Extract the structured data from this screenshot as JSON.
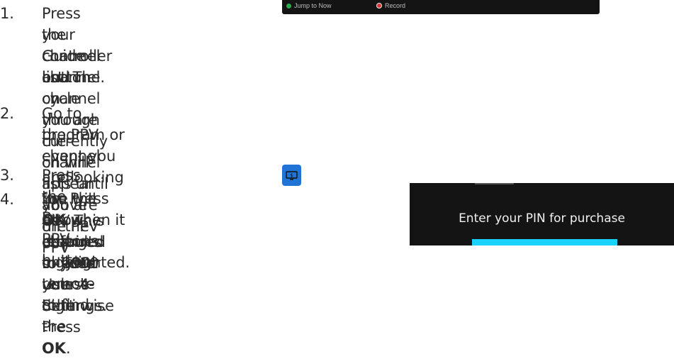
{
  "strip": {
    "jump_label": "Jump to Now",
    "record_label": "Record",
    "jump_color": "#2ea84a",
    "record_color": "#d83232"
  },
  "steps": [
    {
      "number": "1.",
      "lines": [
        "Press the Guide button on",
        "your controller and cycle through the channel lists until you are on the PPV",
        "channel list. The channel you are currently on will appear above the PPV",
        "channel."
      ]
    },
    {
      "number": "2.",
      "line1": "Go to the PPV channel and use the arrow buttons on your remote to find the",
      "line2_pre": "program or event you are looking for. Press ",
      "line2_bold": "OK",
      "line2_post": " when it is highlighted."
    },
    {
      "number": "3.",
      "text": "Press the Buy PPV button:",
      "icon": "buy-ppv-icon"
    },
    {
      "number": "4.",
      "line1": "You will be required to enter your 4-digit",
      "line2": "pin. This defaults to 0000 unless otherwise",
      "line3_pre": "changed in your User Settings. Press ",
      "line3_bold": "OK",
      "line3_post": "."
    }
  ],
  "pin_dialog": {
    "title": "Enter your PIN for purchase",
    "accent": "#19d3ff"
  }
}
